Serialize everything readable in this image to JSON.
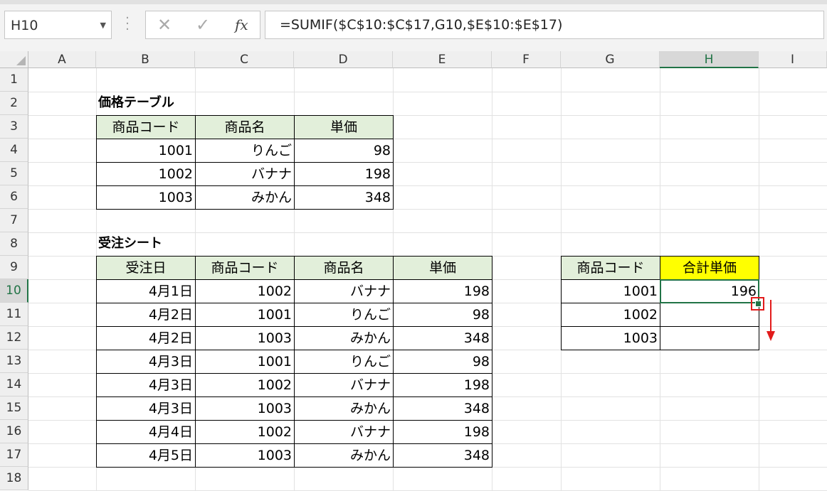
{
  "name_box": {
    "value": "H10"
  },
  "formula_bar": {
    "cancel_glyph": "✕",
    "enter_glyph": "✓",
    "fx_label": "fx",
    "formula": "=SUMIF($C$10:$C$17,G10,$E$10:$E$17)"
  },
  "columns": [
    "A",
    "B",
    "C",
    "D",
    "E",
    "F",
    "G",
    "H",
    "I"
  ],
  "selected_column": "H",
  "rows": [
    "1",
    "2",
    "3",
    "4",
    "5",
    "6",
    "7",
    "8",
    "9",
    "10",
    "11",
    "12",
    "13",
    "14",
    "15",
    "16",
    "17",
    "18"
  ],
  "selected_row": "10",
  "price_table": {
    "title": "価格テーブル",
    "headers": [
      "商品コード",
      "商品名",
      "単価"
    ],
    "rows": [
      [
        "1001",
        "りんご",
        "98"
      ],
      [
        "1002",
        "バナナ",
        "198"
      ],
      [
        "1003",
        "みかん",
        "348"
      ]
    ]
  },
  "order_sheet": {
    "title": "受注シート",
    "headers": [
      "受注日",
      "商品コード",
      "商品名",
      "単価"
    ],
    "rows": [
      [
        "4月1日",
        "1002",
        "バナナ",
        "198"
      ],
      [
        "4月2日",
        "1001",
        "りんご",
        "98"
      ],
      [
        "4月2日",
        "1003",
        "みかん",
        "348"
      ],
      [
        "4月3日",
        "1001",
        "りんご",
        "98"
      ],
      [
        "4月3日",
        "1002",
        "バナナ",
        "198"
      ],
      [
        "4月3日",
        "1003",
        "みかん",
        "348"
      ],
      [
        "4月4日",
        "1002",
        "バナナ",
        "198"
      ],
      [
        "4月5日",
        "1003",
        "みかん",
        "348"
      ]
    ]
  },
  "summary_table": {
    "headers": [
      "商品コード",
      "合計単価"
    ],
    "rows": [
      [
        "1001",
        "196"
      ],
      [
        "1002",
        ""
      ],
      [
        "1003",
        ""
      ]
    ]
  },
  "colors": {
    "accent": "#217346",
    "highlight": "#ffff00",
    "header_fill": "#e2efda",
    "annotation": "#e21b1b"
  }
}
